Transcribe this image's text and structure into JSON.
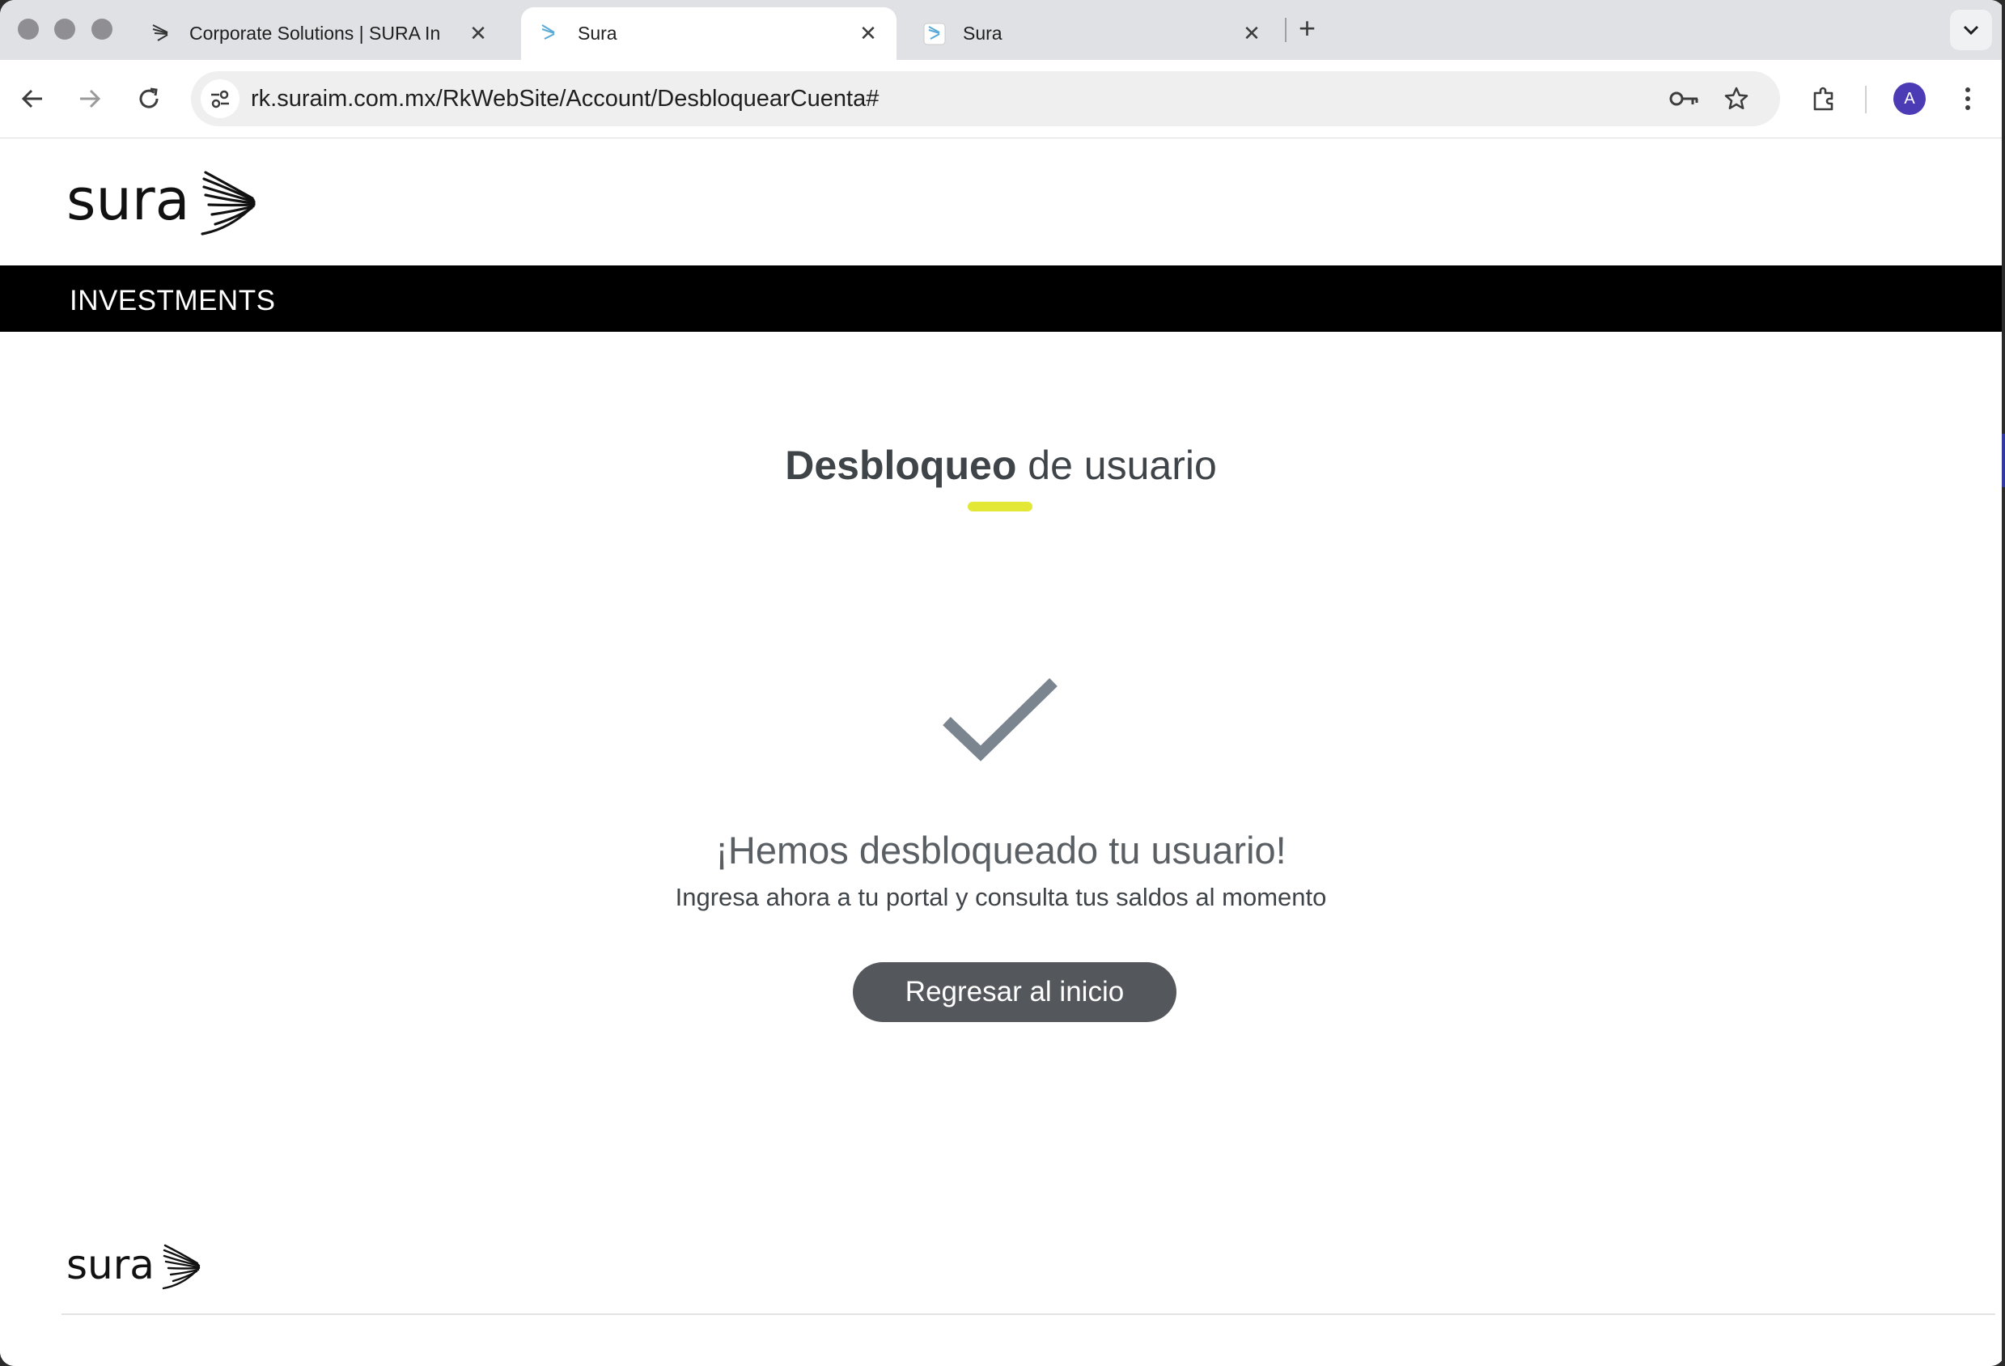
{
  "browser": {
    "tabs": [
      {
        "title": "Corporate Solutions | SURA In",
        "active": false
      },
      {
        "title": "Sura",
        "active": true
      },
      {
        "title": "Sura",
        "active": false
      }
    ],
    "close_glyph": "✕",
    "new_tab_glyph": "+",
    "url": "rk.suraim.com.mx/RkWebSite/Account/DesbloquearCuenta#",
    "profile_initial": "A"
  },
  "page": {
    "logo_text": "sura",
    "nav_label": "INVESTMENTS",
    "heading_bold": "Desbloqueo",
    "heading_rest": " de usuario",
    "success_title": "¡Hemos desbloqueado tu usuario!",
    "success_subtitle": "Ingresa ahora a tu portal y consulta tus saldos al momento",
    "home_button": "Regresar al inicio",
    "footer_logo_text": "sura"
  },
  "colors": {
    "accent": "#e3e836",
    "button": "#54585d",
    "nav_bar": "#000000",
    "check": "#7a8590"
  },
  "icons": [
    "back-icon",
    "forward-icon",
    "reload-icon",
    "site-info-icon",
    "key-icon",
    "star-icon",
    "extensions-icon",
    "kebab-menu-icon",
    "checkmark-icon",
    "chevron-down-icon"
  ]
}
